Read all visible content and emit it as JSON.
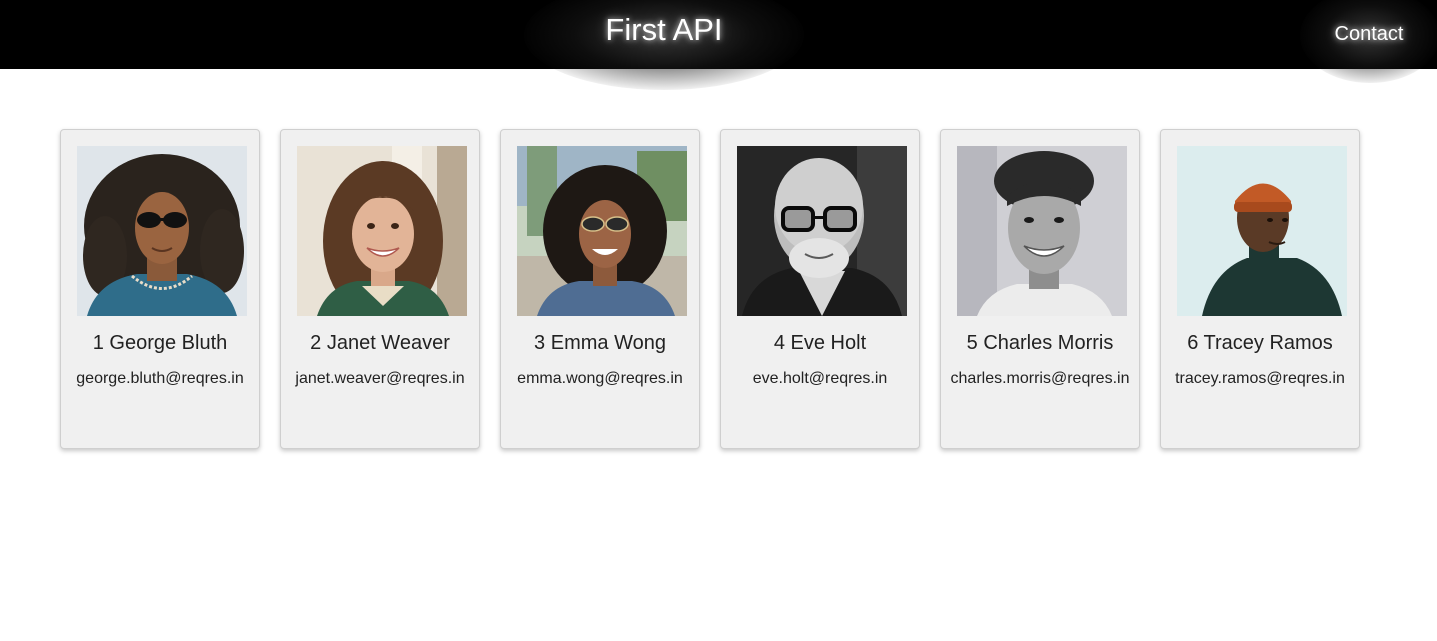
{
  "header": {
    "title": "First API",
    "contact_label": "Contact"
  },
  "users": [
    {
      "id": "1",
      "name": "George Bluth",
      "display": "1 George Bluth",
      "email": "george.bluth@reqres.in",
      "photo_bg": "#dfe5ea"
    },
    {
      "id": "2",
      "name": "Janet Weaver",
      "display": "2 Janet Weaver",
      "email": "janet.weaver@reqres.in",
      "photo_bg": "#e9e2d6"
    },
    {
      "id": "3",
      "name": "Emma Wong",
      "display": "3 Emma Wong",
      "email": "emma.wong@reqres.in",
      "photo_bg": "#c6d3c0"
    },
    {
      "id": "4",
      "name": "Eve Holt",
      "display": "4 Eve Holt",
      "email": "eve.holt@reqres.in",
      "photo_bg": "#262626"
    },
    {
      "id": "5",
      "name": "Charles Morris",
      "display": "5 Charles Morris",
      "email": "charles.morris@reqres.in",
      "photo_bg": "#cfcfd4"
    },
    {
      "id": "6",
      "name": "Tracey Ramos",
      "display": "6 Tracey Ramos",
      "email": "tracey.ramos@reqres.in",
      "photo_bg": "#dcedee"
    }
  ]
}
